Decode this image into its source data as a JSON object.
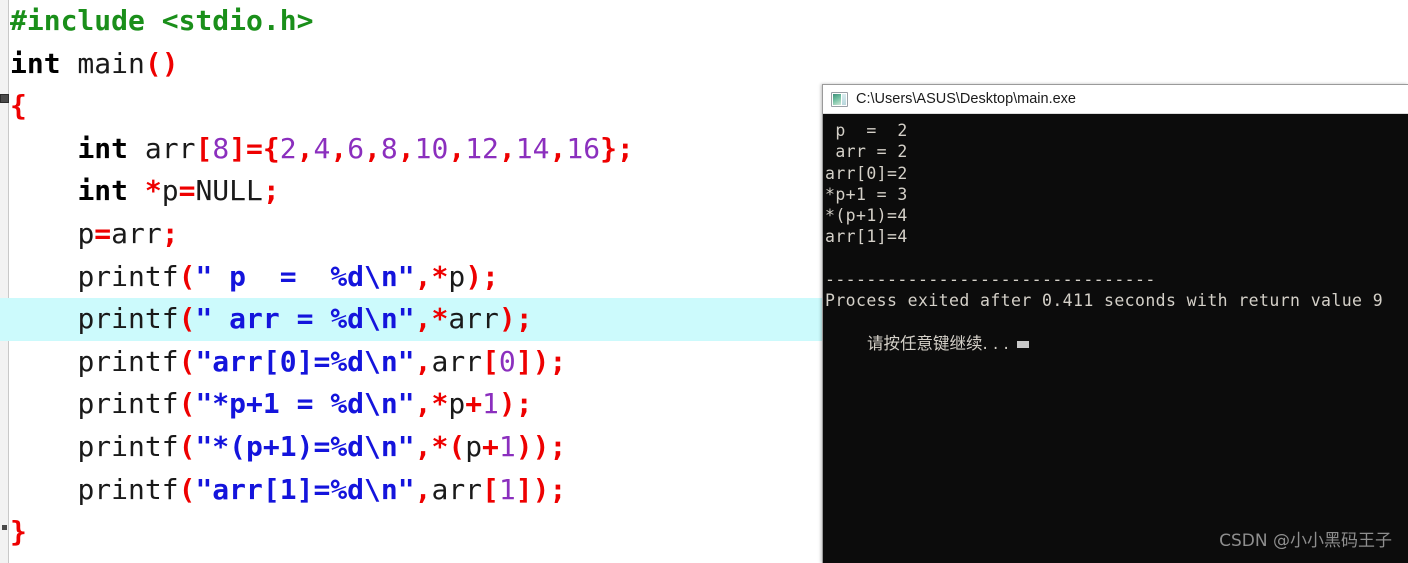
{
  "editor": {
    "name": "c-source-editor",
    "highlight_color": "#ccfafc",
    "highlighted_line_index": 7,
    "lines": [
      {
        "indent": 0,
        "tokens": [
          {
            "c": "pre",
            "t": "#include <stdio.h>"
          }
        ]
      },
      {
        "indent": 0,
        "tokens": [
          {
            "c": "kw",
            "t": "int"
          },
          {
            "c": "id",
            "t": " main"
          },
          {
            "c": "punc",
            "t": "()"
          }
        ]
      },
      {
        "indent": 0,
        "fold": "start",
        "tokens": [
          {
            "c": "punc",
            "t": "{"
          }
        ]
      },
      {
        "indent": 1,
        "tokens": [
          {
            "c": "kw",
            "t": "int"
          },
          {
            "c": "id",
            "t": " arr"
          },
          {
            "c": "punc",
            "t": "["
          },
          {
            "c": "num",
            "t": "8"
          },
          {
            "c": "punc",
            "t": "]={"
          },
          {
            "c": "num",
            "t": "2"
          },
          {
            "c": "punc",
            "t": ","
          },
          {
            "c": "num",
            "t": "4"
          },
          {
            "c": "punc",
            "t": ","
          },
          {
            "c": "num",
            "t": "6"
          },
          {
            "c": "punc",
            "t": ","
          },
          {
            "c": "num",
            "t": "8"
          },
          {
            "c": "punc",
            "t": ","
          },
          {
            "c": "num",
            "t": "10"
          },
          {
            "c": "punc",
            "t": ","
          },
          {
            "c": "num",
            "t": "12"
          },
          {
            "c": "punc",
            "t": ","
          },
          {
            "c": "num",
            "t": "14"
          },
          {
            "c": "punc",
            "t": ","
          },
          {
            "c": "num",
            "t": "16"
          },
          {
            "c": "punc",
            "t": "};"
          }
        ]
      },
      {
        "indent": 1,
        "tokens": [
          {
            "c": "kw",
            "t": "int"
          },
          {
            "c": "punc",
            "t": " *"
          },
          {
            "c": "id",
            "t": "p"
          },
          {
            "c": "punc",
            "t": "="
          },
          {
            "c": "id",
            "t": "NULL"
          },
          {
            "c": "punc",
            "t": ";"
          }
        ]
      },
      {
        "indent": 1,
        "tokens": [
          {
            "c": "id",
            "t": "p"
          },
          {
            "c": "punc",
            "t": "="
          },
          {
            "c": "id",
            "t": "arr"
          },
          {
            "c": "punc",
            "t": ";"
          }
        ]
      },
      {
        "indent": 1,
        "tokens": [
          {
            "c": "id",
            "t": "printf"
          },
          {
            "c": "punc",
            "t": "("
          },
          {
            "c": "str",
            "t": "\" p  =  %d\\n\""
          },
          {
            "c": "punc",
            "t": ",*"
          },
          {
            "c": "id",
            "t": "p"
          },
          {
            "c": "punc",
            "t": ");"
          }
        ]
      },
      {
        "indent": 1,
        "tokens": [
          {
            "c": "id",
            "t": "printf"
          },
          {
            "c": "punc",
            "t": "("
          },
          {
            "c": "str",
            "t": "\" arr = %d\\n\""
          },
          {
            "c": "punc",
            "t": ",*"
          },
          {
            "c": "id",
            "t": "arr"
          },
          {
            "c": "punc",
            "t": ");"
          }
        ]
      },
      {
        "indent": 1,
        "tokens": [
          {
            "c": "id",
            "t": "printf"
          },
          {
            "c": "punc",
            "t": "("
          },
          {
            "c": "str",
            "t": "\"arr[0]=%d\\n\""
          },
          {
            "c": "punc",
            "t": ","
          },
          {
            "c": "id",
            "t": "arr"
          },
          {
            "c": "punc",
            "t": "["
          },
          {
            "c": "num",
            "t": "0"
          },
          {
            "c": "punc",
            "t": "]);"
          }
        ]
      },
      {
        "indent": 1,
        "tokens": [
          {
            "c": "id",
            "t": "printf"
          },
          {
            "c": "punc",
            "t": "("
          },
          {
            "c": "str",
            "t": "\"*p+1 = %d\\n\""
          },
          {
            "c": "punc",
            "t": ",*"
          },
          {
            "c": "id",
            "t": "p"
          },
          {
            "c": "punc",
            "t": "+"
          },
          {
            "c": "num",
            "t": "1"
          },
          {
            "c": "punc",
            "t": ");"
          }
        ]
      },
      {
        "indent": 1,
        "tokens": [
          {
            "c": "id",
            "t": "printf"
          },
          {
            "c": "punc",
            "t": "("
          },
          {
            "c": "str",
            "t": "\"*(p+1)=%d\\n\""
          },
          {
            "c": "punc",
            "t": ",*("
          },
          {
            "c": "id",
            "t": "p"
          },
          {
            "c": "punc",
            "t": "+"
          },
          {
            "c": "num",
            "t": "1"
          },
          {
            "c": "punc",
            "t": "));"
          }
        ]
      },
      {
        "indent": 1,
        "tokens": [
          {
            "c": "id",
            "t": "printf"
          },
          {
            "c": "punc",
            "t": "("
          },
          {
            "c": "str",
            "t": "\"arr[1]=%d\\n\""
          },
          {
            "c": "punc",
            "t": ","
          },
          {
            "c": "id",
            "t": "arr"
          },
          {
            "c": "punc",
            "t": "["
          },
          {
            "c": "num",
            "t": "1"
          },
          {
            "c": "punc",
            "t": "]);"
          }
        ]
      },
      {
        "indent": 0,
        "fold": "end",
        "tokens": [
          {
            "c": "punc",
            "t": "}"
          }
        ]
      }
    ]
  },
  "console": {
    "title": "C:\\Users\\ASUS\\Desktop\\main.exe",
    "icon": "console-window-icon",
    "background": "#0c0c0c",
    "text_color": "#d4d0c8",
    "output_lines": [
      " p  =  2",
      " arr = 2",
      "arr[0]=2",
      "*p+1 = 3",
      "*(p+1)=4",
      "arr[1]=4"
    ],
    "separator": "--------------------------------",
    "exit_message": "Process exited after 0.411 seconds with return value 9",
    "prompt_message": "请按任意键继续. . .",
    "cursor": "block-cursor"
  },
  "watermark": {
    "text": "CSDN @小小黑码王子"
  }
}
